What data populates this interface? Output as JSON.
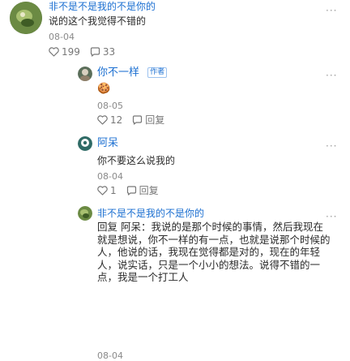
{
  "comments": [
    {
      "author": "非不是不是我的不是你的",
      "text": "说的这个我觉得不错的",
      "date": "08-04",
      "likes": "199",
      "replies": "33",
      "more": "···"
    }
  ],
  "replies": [
    {
      "author": "你不一样",
      "tag": "作者",
      "text": "🍪",
      "date": "08-05",
      "likes": "12",
      "reply_label": "回复",
      "more": "···"
    },
    {
      "author": "阿呆",
      "text": "你不要这么说我的",
      "date": "08-04",
      "likes": "1",
      "reply_label": "回复",
      "more": "···"
    },
    {
      "author": "非不是不是我的不是你的",
      "prefix": "回复 阿呆：",
      "text": "我说的是那个时候的事情，然后我现在就是想说，你不一样的有一点，也就是说那个时候的人，他说的话，我现在觉得都是对的，现在的年轻人，说实话，只是一个小小的想法。说得不错的一点，我是一个打工人",
      "date": "08-04",
      "more": "···"
    }
  ],
  "colors": {
    "name": "#1b6fd1",
    "text": "#2b2b2b",
    "meta": "#8a8a8a"
  },
  "icons": [
    "heart-icon",
    "comment-icon",
    "more-icon"
  ]
}
